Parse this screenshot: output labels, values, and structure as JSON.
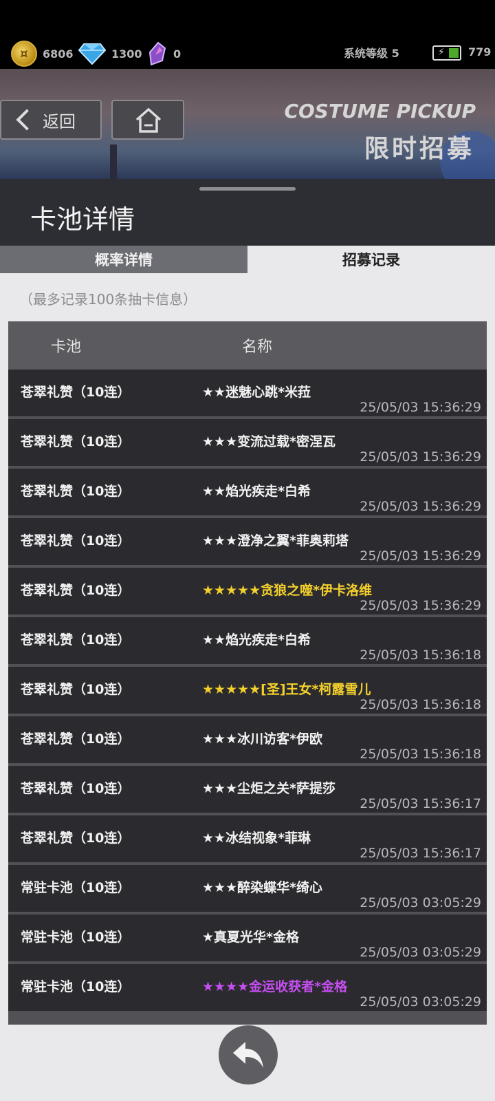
{
  "resources": {
    "gold": "6806",
    "diamond": "1300",
    "crystal": "0",
    "system_level": "系统等级 5",
    "battery": "779"
  },
  "nav": {
    "back_label": "返回",
    "banner_title_en": "COSTUME PICKUP",
    "banner_title_cn": "限时招募"
  },
  "panel": {
    "title": "卡池详情",
    "tabs": [
      "概率详情",
      "招募记录"
    ],
    "active_tab": "招募记录",
    "note": "（最多记录100条抽卡信息）",
    "columns": [
      "卡池",
      "名称"
    ],
    "records": [
      {
        "pool": "苍翠礼赞（10连）",
        "name": "★★迷魅心跳*米菈",
        "time": "25/05/03 15:36:29",
        "rarity": "normal"
      },
      {
        "pool": "苍翠礼赞（10连）",
        "name": "★★★变流过载*密涅瓦",
        "time": "25/05/03 15:36:29",
        "rarity": "normal"
      },
      {
        "pool": "苍翠礼赞（10连）",
        "name": "★★焰光疾走*白希",
        "time": "25/05/03 15:36:29",
        "rarity": "normal"
      },
      {
        "pool": "苍翠礼赞（10连）",
        "name": "★★★澄净之翼*菲奥莉塔",
        "time": "25/05/03 15:36:29",
        "rarity": "normal"
      },
      {
        "pool": "苍翠礼赞（10连）",
        "name": "★★★★★贪狼之噬*伊卡洛维",
        "time": "25/05/03 15:36:29",
        "rarity": "gold"
      },
      {
        "pool": "苍翠礼赞（10连）",
        "name": "★★焰光疾走*白希",
        "time": "25/05/03 15:36:18",
        "rarity": "normal"
      },
      {
        "pool": "苍翠礼赞（10连）",
        "name": "★★★★★[圣]王女*柯露雪儿",
        "time": "25/05/03 15:36:18",
        "rarity": "gold"
      },
      {
        "pool": "苍翠礼赞（10连）",
        "name": "★★★冰川访客*伊欧",
        "time": "25/05/03 15:36:18",
        "rarity": "normal"
      },
      {
        "pool": "苍翠礼赞（10连）",
        "name": "★★★尘炬之关*萨提莎",
        "time": "25/05/03 15:36:17",
        "rarity": "normal"
      },
      {
        "pool": "苍翠礼赞（10连）",
        "name": "★★冰结视象*菲琳",
        "time": "25/05/03 15:36:17",
        "rarity": "normal"
      },
      {
        "pool": "常驻卡池（10连）",
        "name": "★★★醉染蝶华*绮心",
        "time": "25/05/03 03:05:29",
        "rarity": "normal"
      },
      {
        "pool": "常驻卡池（10连）",
        "name": "★真夏光华*金格",
        "time": "25/05/03 03:05:29",
        "rarity": "normal"
      },
      {
        "pool": "常驻卡池（10连）",
        "name": "★★★★金运收获者*金格",
        "time": "25/05/03 03:05:29",
        "rarity": "purple"
      }
    ]
  },
  "colors": {
    "gold_rarity": "#f4d02c",
    "purple_rarity": "#c64ef2",
    "panel_bg": "#2d2e33",
    "content_bg": "#e9e9ec"
  },
  "icons": [
    "coin-icon",
    "diamond-icon",
    "crystal-icon",
    "battery-icon",
    "chevron-left-icon",
    "home-icon",
    "return-arrow-icon"
  ]
}
